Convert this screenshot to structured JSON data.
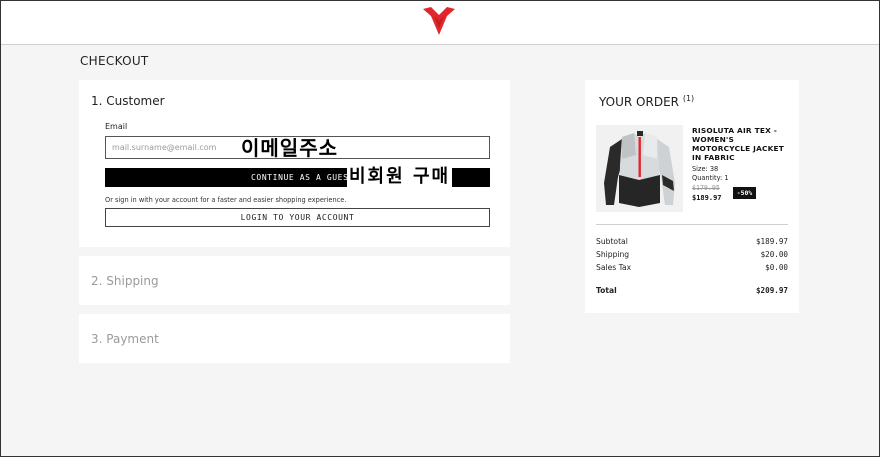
{
  "brand": {
    "name": "Dainese",
    "accent": "#e3262b"
  },
  "page": {
    "title": "CHECKOUT"
  },
  "customer": {
    "step_title": "1. Customer",
    "email_label": "Email",
    "email_placeholder": "mail.surname@email.com",
    "email_value": "",
    "annotation_email": "이메일주소",
    "guest_button": "CONTINUE AS A GUEST",
    "annotation_guest": "비회원 구매",
    "signin_note": "Or sign in with your account for a faster and easier shopping experience.",
    "login_button": "LOGIN TO YOUR ACCOUNT"
  },
  "shipping": {
    "step_title": "2. Shipping"
  },
  "payment": {
    "step_title": "3. Payment"
  },
  "order": {
    "title": "YOUR ORDER",
    "count": "(1)",
    "item": {
      "name": "RISOLUTA AIR TEX - WOMEN'S MOTORCYCLE JACKET IN FABRIC",
      "size": "Size: 38",
      "quantity": "Quantity: 1",
      "price_old": "$179.95",
      "price_new": "$189.97",
      "discount": "-50%",
      "image_icon": "jacket-image"
    },
    "summary": [
      {
        "label": "Subtotal",
        "value": "$189.97"
      },
      {
        "label": "Shipping",
        "value": "$20.00"
      },
      {
        "label": "Sales Tax",
        "value": "$0.00"
      }
    ],
    "total": {
      "label": "Total",
      "value": "$209.97"
    }
  }
}
